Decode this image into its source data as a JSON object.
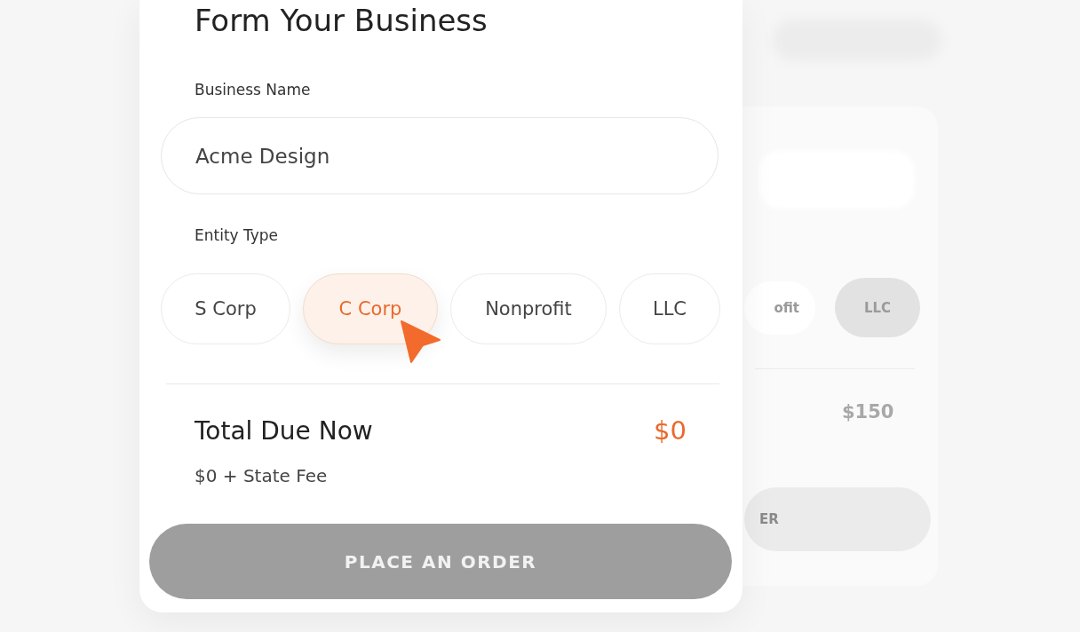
{
  "form": {
    "title": "Form Your Business",
    "business_name": {
      "label": "Business Name",
      "value": "Acme Design"
    },
    "entity_type": {
      "label": "Entity Type",
      "options": [
        {
          "label": "S Corp",
          "selected": false
        },
        {
          "label": "C Corp",
          "selected": true
        },
        {
          "label": "Nonprofit",
          "selected": false
        },
        {
          "label": "LLC",
          "selected": false
        }
      ]
    },
    "total": {
      "label": "Total Due Now",
      "amount": "$0",
      "note": "$0 + State Fee"
    },
    "submit_button": {
      "label": "PLACE AN ORDER",
      "disabled": true
    }
  },
  "background_card": {
    "options": [
      {
        "label": "ofit",
        "selected": false
      },
      {
        "label": "LLC",
        "selected": true
      }
    ],
    "amount": "$150",
    "button": "ER"
  }
}
